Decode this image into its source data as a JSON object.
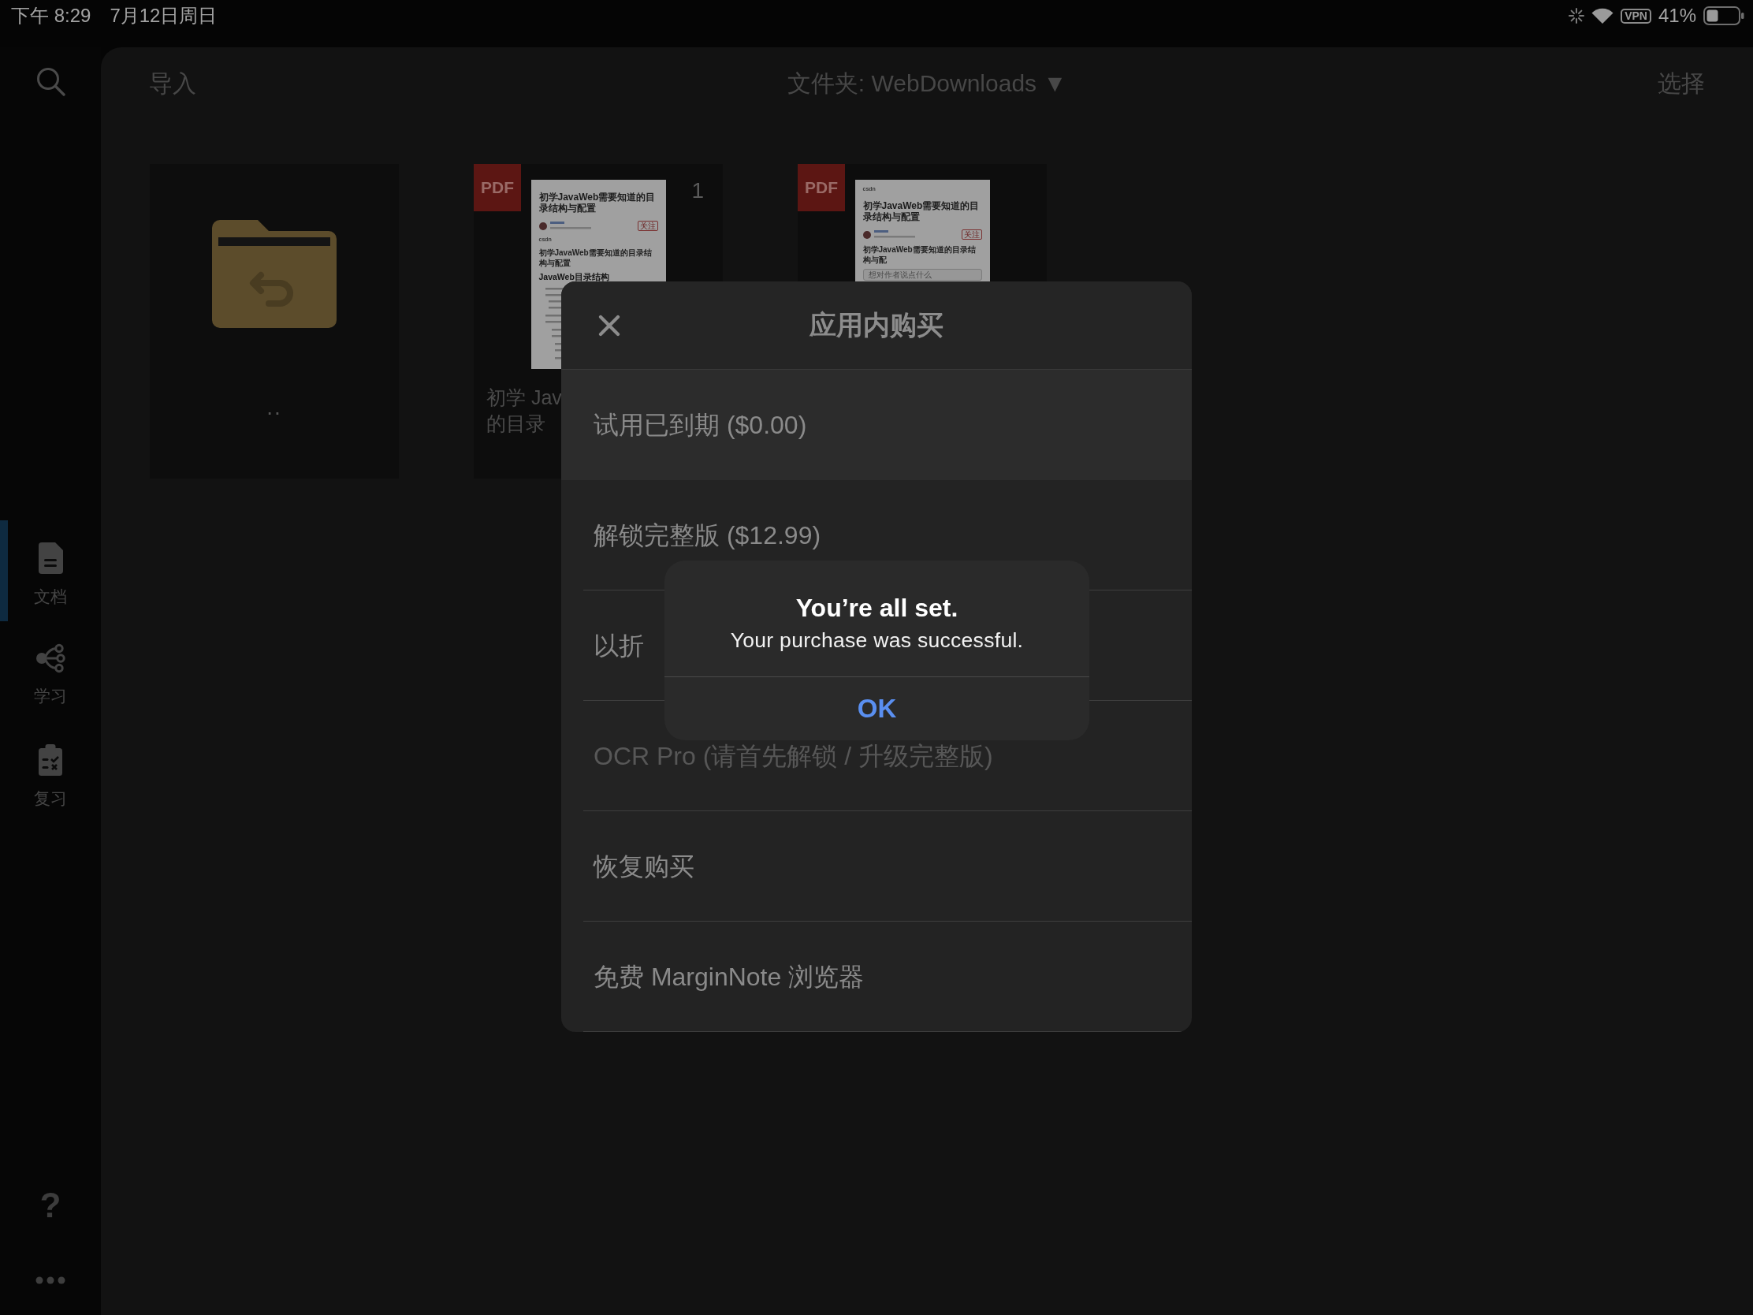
{
  "status_bar": {
    "time": "下午 8:29",
    "date": "7月12日周日",
    "vpn": "VPN",
    "battery": "41%"
  },
  "rail": {
    "items": [
      {
        "kind": "document",
        "label": "文档",
        "selected": true
      },
      {
        "kind": "mindmap",
        "label": "学习",
        "selected": false
      },
      {
        "kind": "review",
        "label": "复习",
        "selected": false
      }
    ],
    "help": "?"
  },
  "toolbar": {
    "import": "导入",
    "folder": "文件夹: WebDownloads",
    "folder_caret": "▼",
    "select": "选择"
  },
  "files": [
    {
      "kind": "parent_folder",
      "name_lines": [
        ".."
      ]
    },
    {
      "kind": "pdf",
      "badge": "PDF",
      "count": "1",
      "name_lines": [
        "初学 Jav",
        "的目录"
      ],
      "preview": [
        {
          "kind": "title",
          "text": "初学JavaWeb需要知道的目录结构与配置"
        },
        {
          "kind": "author",
          "follow": "关注"
        },
        {
          "kind": "logo",
          "text": "csdn"
        },
        {
          "kind": "heading",
          "text": "初学JavaWeb需要知道的目录结构与配置"
        },
        {
          "kind": "subheading",
          "text": "JavaWeb目录结构"
        },
        {
          "kind": "body"
        }
      ]
    },
    {
      "kind": "pdf",
      "badge": "PDF",
      "preview": [
        {
          "kind": "logo",
          "text": "csdn"
        },
        {
          "kind": "title",
          "text": "初学JavaWeb需要知道的目录结构与配置"
        },
        {
          "kind": "author",
          "follow": "关注"
        },
        {
          "kind": "heading",
          "text": "初学JavaWeb需要知道的目录结构与配"
        },
        {
          "kind": "comment",
          "placeholder": "想对作者说点什么"
        }
      ]
    }
  ],
  "purchase_sheet": {
    "title": "应用内购买",
    "items": [
      {
        "label": "试用已到期 ($0.00)",
        "selected": true,
        "disabled": false
      },
      {
        "label": "解锁完整版 ($12.99)",
        "selected": false,
        "disabled": false
      },
      {
        "label": "以折",
        "selected": false,
        "disabled": false
      },
      {
        "label": "OCR Pro (请首先解锁 / 升级完整版)",
        "selected": false,
        "disabled": true
      },
      {
        "label": "恢复购买",
        "selected": false,
        "disabled": false
      },
      {
        "label": "免费 MarginNote 浏览器",
        "selected": false,
        "disabled": false
      }
    ]
  },
  "alert": {
    "title": "You’re all set.",
    "message": "Your purchase was successful.",
    "button": "OK"
  }
}
